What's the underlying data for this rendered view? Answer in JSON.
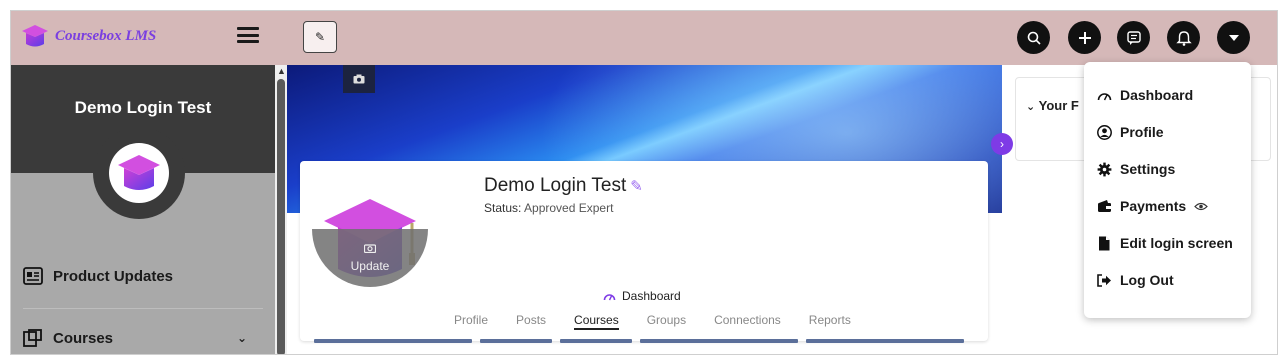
{
  "header": {
    "logo_text": "Coursebox LMS",
    "edit_icon": "pencil-icon",
    "icons": [
      "search-icon",
      "plus-icon",
      "chat-icon",
      "bell-icon",
      "chevron-down-icon"
    ]
  },
  "sidebar": {
    "user_name": "Demo Login Test",
    "items": [
      {
        "label": "Product Updates",
        "icon": "newspaper-icon"
      },
      {
        "label": "Courses",
        "icon": "courses-icon"
      }
    ]
  },
  "profile": {
    "name": "Demo Login Test",
    "status_label": "Status:",
    "status_value": "Approved Expert",
    "update_label": "Update",
    "dashboard_label": "Dashboard",
    "tabs": [
      "Profile",
      "Posts",
      "Courses",
      "Groups",
      "Connections",
      "Reports"
    ],
    "active_tab": "Courses"
  },
  "right_panel": {
    "title": "Your F"
  },
  "dropdown": {
    "items": [
      {
        "label": "Dashboard",
        "icon": "gauge-icon"
      },
      {
        "label": "Profile",
        "icon": "user-circle-icon"
      },
      {
        "label": "Settings",
        "icon": "gear-icon"
      },
      {
        "label": "Payments",
        "icon": "wallet-icon"
      },
      {
        "label": "Edit login screen",
        "icon": "file-icon"
      },
      {
        "label": "Log Out",
        "icon": "logout-icon"
      }
    ]
  },
  "colors": {
    "header_bg": "#d5b8b8",
    "accent": "#7e3be6",
    "sidebar_bg": "#a9a9a9",
    "sidebar_head_bg": "#3a3a3a"
  }
}
